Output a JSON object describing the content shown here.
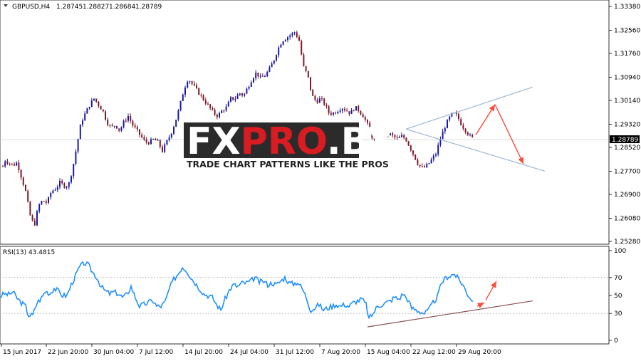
{
  "chart_data": [
    {
      "type": "candlestick",
      "symbol_header": "GBPUSD,H4",
      "ohlc_header": [
        "1.28745",
        "1.28827",
        "1.28684",
        "1.28789"
      ],
      "y_ticks": [
        "1.33380",
        "1.32560",
        "1.31760",
        "1.30940",
        "1.30140",
        "1.29320",
        "1.28520",
        "1.27700",
        "1.26900",
        "1.26080",
        "1.25280"
      ],
      "ylim": [
        1.2528,
        1.3338
      ],
      "current_price": "1.28789",
      "x_ticks": [
        "15 Jun 2017",
        "22 Jun 20:00",
        "30 Jun 04:00",
        "7 Jul 12:00",
        "14 Jul 20:00",
        "24 Jul 04:00",
        "31 Jul 12:00",
        "7 Aug 20:00",
        "15 Aug 04:00",
        "22 Aug 12:00",
        "29 Aug 20:00"
      ],
      "close_path": [
        [
          0,
          1.274
        ],
        [
          6,
          1.281
        ],
        [
          12,
          1.28
        ],
        [
          18,
          1.279
        ],
        [
          24,
          1.28
        ],
        [
          30,
          1.275
        ],
        [
          36,
          1.27
        ],
        [
          42,
          1.262
        ],
        [
          48,
          1.258
        ],
        [
          54,
          1.265
        ],
        [
          60,
          1.267
        ],
        [
          66,
          1.266
        ],
        [
          72,
          1.27
        ],
        [
          78,
          1.271
        ],
        [
          84,
          1.273
        ],
        [
          90,
          1.272
        ],
        [
          96,
          1.272
        ],
        [
          102,
          1.278
        ],
        [
          108,
          1.286
        ],
        [
          114,
          1.294
        ],
        [
          120,
          1.297
        ],
        [
          126,
          1.3
        ],
        [
          132,
          1.302
        ],
        [
          138,
          1.3
        ],
        [
          144,
          1.298
        ],
        [
          150,
          1.294
        ],
        [
          156,
          1.292
        ],
        [
          162,
          1.293
        ],
        [
          168,
          1.291
        ],
        [
          174,
          1.294
        ],
        [
          180,
          1.296
        ],
        [
          186,
          1.293
        ],
        [
          192,
          1.291
        ],
        [
          198,
          1.289
        ],
        [
          204,
          1.287
        ],
        [
          210,
          1.287
        ],
        [
          216,
          1.288
        ],
        [
          222,
          1.287
        ],
        [
          228,
          1.284
        ],
        [
          234,
          1.287
        ],
        [
          240,
          1.29
        ],
        [
          246,
          1.294
        ],
        [
          252,
          1.299
        ],
        [
          258,
          1.305
        ],
        [
          264,
          1.309
        ],
        [
          270,
          1.307
        ],
        [
          276,
          1.305
        ],
        [
          282,
          1.303
        ],
        [
          288,
          1.301
        ],
        [
          294,
          1.299
        ],
        [
          300,
          1.297
        ],
        [
          306,
          1.296
        ],
        [
          312,
          1.298
        ],
        [
          318,
          1.299
        ],
        [
          324,
          1.302
        ],
        [
          330,
          1.302
        ],
        [
          336,
          1.304
        ],
        [
          342,
          1.303
        ],
        [
          348,
          1.306
        ],
        [
          354,
          1.309
        ],
        [
          360,
          1.311
        ],
        [
          366,
          1.309
        ],
        [
          372,
          1.31
        ],
        [
          378,
          1.312
        ],
        [
          384,
          1.315
        ],
        [
          390,
          1.319
        ],
        [
          396,
          1.322
        ],
        [
          402,
          1.323
        ],
        [
          408,
          1.324
        ],
        [
          414,
          1.325
        ],
        [
          420,
          1.322
        ],
        [
          426,
          1.313
        ],
        [
          432,
          1.31
        ],
        [
          438,
          1.303
        ],
        [
          444,
          1.301
        ],
        [
          450,
          1.302
        ],
        [
          456,
          1.3
        ],
        [
          462,
          1.297
        ],
        [
          468,
          1.297
        ],
        [
          474,
          1.298
        ],
        [
          480,
          1.299
        ],
        [
          486,
          1.298
        ],
        [
          492,
          1.297
        ],
        [
          498,
          1.299
        ],
        [
          504,
          1.298
        ],
        [
          510,
          1.296
        ],
        [
          516,
          1.293
        ],
        [
          522,
          1.289
        ],
        [
          528,
          1.287
        ],
        [
          534,
          1.288
        ],
        [
          540,
          1.289
        ],
        [
          546,
          1.29
        ],
        [
          552,
          1.289
        ],
        [
          558,
          1.288
        ],
        [
          564,
          1.289
        ],
        [
          570,
          1.288
        ],
        [
          576,
          1.285
        ],
        [
          582,
          1.282
        ],
        [
          588,
          1.279
        ],
        [
          594,
          1.278
        ],
        [
          600,
          1.279
        ],
        [
          606,
          1.281
        ],
        [
          612,
          1.283
        ],
        [
          618,
          1.288
        ],
        [
          624,
          1.292
        ],
        [
          630,
          1.295
        ],
        [
          636,
          1.297
        ],
        [
          642,
          1.296
        ],
        [
          648,
          1.293
        ],
        [
          654,
          1.291
        ],
        [
          660,
          1.289
        ],
        [
          666,
          1.2879
        ]
      ],
      "channel_lines": [
        {
          "from": [
            570,
            1.2915
          ],
          "to": [
            748,
            1.306
          ]
        },
        {
          "from": [
            570,
            1.2915
          ],
          "to": [
            765,
            1.277
          ]
        }
      ],
      "projection_arrows": [
        [
          [
            668,
            1.2895
          ],
          [
            695,
            1.3
          ]
        ],
        [
          [
            695,
            1.3
          ],
          [
            735,
            1.2795
          ]
        ]
      ]
    },
    {
      "type": "line",
      "label_header": "RSI(13) 43.4815",
      "y_ticks": [
        "100",
        "70",
        "50",
        "30",
        "0"
      ],
      "ylim": [
        0,
        100
      ],
      "rsi_path": [
        [
          0,
          49
        ],
        [
          6,
          52
        ],
        [
          12,
          51
        ],
        [
          18,
          54
        ],
        [
          24,
          47
        ],
        [
          30,
          42
        ],
        [
          36,
          38
        ],
        [
          40,
          28
        ],
        [
          46,
          28
        ],
        [
          52,
          42
        ],
        [
          58,
          47
        ],
        [
          64,
          55
        ],
        [
          70,
          52
        ],
        [
          76,
          58
        ],
        [
          82,
          55
        ],
        [
          88,
          50
        ],
        [
          94,
          50
        ],
        [
          100,
          62
        ],
        [
          106,
          72
        ],
        [
          112,
          82
        ],
        [
          118,
          86
        ],
        [
          124,
          84
        ],
        [
          130,
          76
        ],
        [
          136,
          70
        ],
        [
          142,
          60
        ],
        [
          148,
          55
        ],
        [
          154,
          52
        ],
        [
          160,
          54
        ],
        [
          166,
          52
        ],
        [
          172,
          48
        ],
        [
          178,
          51
        ],
        [
          184,
          60
        ],
        [
          190,
          48
        ],
        [
          196,
          38
        ],
        [
          202,
          40
        ],
        [
          208,
          42
        ],
        [
          214,
          45
        ],
        [
          220,
          38
        ],
        [
          226,
          38
        ],
        [
          232,
          43
        ],
        [
          238,
          58
        ],
        [
          244,
          68
        ],
        [
          250,
          74
        ],
        [
          256,
          82
        ],
        [
          262,
          78
        ],
        [
          268,
          70
        ],
        [
          274,
          64
        ],
        [
          280,
          58
        ],
        [
          286,
          52
        ],
        [
          292,
          50
        ],
        [
          298,
          48
        ],
        [
          304,
          40
        ],
        [
          310,
          34
        ],
        [
          316,
          46
        ],
        [
          322,
          56
        ],
        [
          328,
          62
        ],
        [
          334,
          60
        ],
        [
          340,
          64
        ],
        [
          346,
          64
        ],
        [
          352,
          66
        ],
        [
          358,
          70
        ],
        [
          364,
          65
        ],
        [
          370,
          66
        ],
        [
          376,
          62
        ],
        [
          382,
          64
        ],
        [
          388,
          62
        ],
        [
          394,
          66
        ],
        [
          400,
          70
        ],
        [
          406,
          64
        ],
        [
          412,
          63
        ],
        [
          418,
          65
        ],
        [
          424,
          58
        ],
        [
          430,
          48
        ],
        [
          436,
          34
        ],
        [
          442,
          36
        ],
        [
          448,
          40
        ],
        [
          454,
          34
        ],
        [
          460,
          36
        ],
        [
          466,
          38
        ],
        [
          472,
          40
        ],
        [
          478,
          38
        ],
        [
          484,
          40
        ],
        [
          490,
          38
        ],
        [
          496,
          42
        ],
        [
          502,
          44
        ],
        [
          508,
          46
        ],
        [
          514,
          40
        ],
        [
          518,
          24
        ],
        [
          524,
          30
        ],
        [
          530,
          38
        ],
        [
          536,
          40
        ],
        [
          542,
          42
        ],
        [
          548,
          44
        ],
        [
          554,
          48
        ],
        [
          560,
          46
        ],
        [
          566,
          52
        ],
        [
          572,
          46
        ],
        [
          578,
          36
        ],
        [
          584,
          34
        ],
        [
          590,
          32
        ],
        [
          596,
          30
        ],
        [
          602,
          34
        ],
        [
          608,
          42
        ],
        [
          614,
          48
        ],
        [
          620,
          64
        ],
        [
          626,
          70
        ],
        [
          632,
          72
        ],
        [
          638,
          74
        ],
        [
          644,
          68
        ],
        [
          650,
          62
        ],
        [
          656,
          52
        ],
        [
          660,
          48
        ],
        [
          664,
          43.48
        ]
      ],
      "support_line": {
        "from": [
          516,
          15
        ],
        "to": [
          748,
          44
        ]
      },
      "projection_arrows": [
        [
          [
            670,
            38
          ],
          [
            680,
            42
          ]
        ],
        [
          [
            682,
            45
          ],
          [
            697,
            66
          ]
        ]
      ]
    }
  ],
  "watermark": {
    "title_fx": "FX",
    "title_pro": "PRO",
    "title_by": ".BY",
    "subtitle": "TRADE CHART PATTERNS LIKE THE PROS"
  },
  "colors": {
    "bull": "#1a1aa0",
    "bear": "#7a1a2a",
    "rsi": "#1e8fff",
    "channel": "#9fb7d6",
    "arrow": "#ff4a3c",
    "support": "#8b5050",
    "wm_fx": "#ffffff",
    "wm_pro": "#d91c22",
    "wm_bg": "#2b2b2b"
  }
}
